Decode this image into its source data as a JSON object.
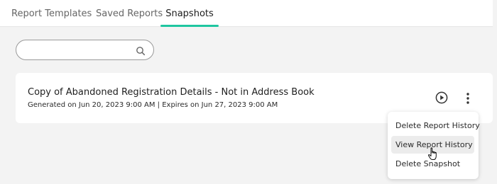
{
  "tabs": [
    {
      "label": "Report Templates",
      "active": false
    },
    {
      "label": "Saved Reports",
      "active": false
    },
    {
      "label": "Snapshots",
      "active": true
    }
  ],
  "accent_color": "#1fc6a0",
  "search": {
    "value": "",
    "placeholder": "",
    "icon": "search-icon"
  },
  "snapshot": {
    "title": "Copy of Abandoned Registration Details - Not in Address Book",
    "meta": "Generated on Jun 20, 2023 9:00 AM | Expires on Jun 27, 2023 9:00 AM",
    "run_icon": "play-circle-icon",
    "more_icon": "more-vertical-icon"
  },
  "menu": {
    "items": [
      {
        "label": "Delete Report History"
      },
      {
        "label": "View Report History",
        "hovered": true
      },
      {
        "label": "Delete Snapshot"
      }
    ]
  },
  "cursor_icon": "hand-pointer-icon"
}
